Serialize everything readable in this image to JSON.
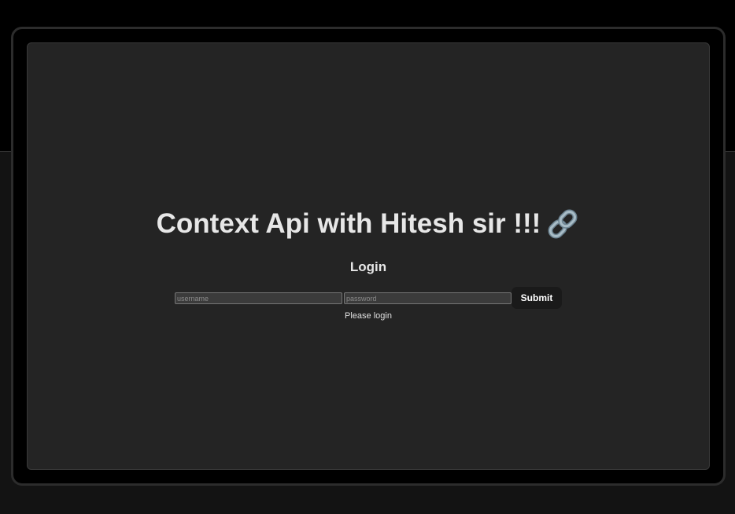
{
  "app": {
    "title": "Context Api with Hitesh sir !!!",
    "title_icon": "link-icon"
  },
  "login": {
    "heading": "Login",
    "username_placeholder": "username",
    "password_placeholder": "password",
    "username_value": "",
    "password_value": "",
    "submit_label": "Submit",
    "status": "Please login"
  },
  "colors": {
    "page_background": "#131313",
    "top_band": "#000000",
    "screen_background": "#242424",
    "text": "#e7e7e7",
    "button_background": "#1a1a1a",
    "input_background": "#3b3b3b",
    "icon_chain": "#8fa6b2"
  }
}
